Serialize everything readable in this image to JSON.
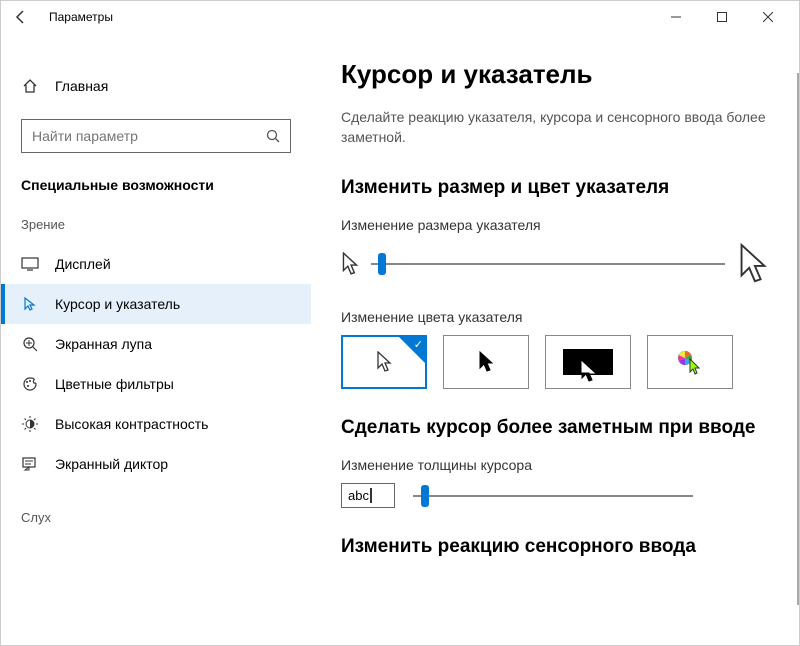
{
  "titlebar": {
    "title": "Параметры"
  },
  "sidebar": {
    "home": "Главная",
    "search_placeholder": "Найти параметр",
    "category": "Специальные возможности",
    "section_vision": "Зрение",
    "section_hearing": "Слух",
    "items": [
      {
        "icon": "display",
        "label": "Дисплей"
      },
      {
        "icon": "cursor",
        "label": "Курсор и указатель"
      },
      {
        "icon": "magnifier",
        "label": "Экранная лупа"
      },
      {
        "icon": "color-filters",
        "label": "Цветные фильтры"
      },
      {
        "icon": "high-contrast",
        "label": "Высокая контрастность"
      },
      {
        "icon": "narrator",
        "label": "Экранный диктор"
      }
    ]
  },
  "main": {
    "title": "Курсор и указатель",
    "description": "Сделайте реакцию указателя, курсора и сенсорного ввода более заметной.",
    "section_size_color": "Изменить размер и цвет указателя",
    "pointer_size_label": "Изменение размера указателя",
    "pointer_color_label": "Изменение цвета указателя",
    "section_cursor": "Сделать курсор более заметным при вводе",
    "cursor_thickness_label": "Изменение толщины курсора",
    "thickness_preview": "abc",
    "section_touch": "Изменить реакцию сенсорного ввода"
  }
}
